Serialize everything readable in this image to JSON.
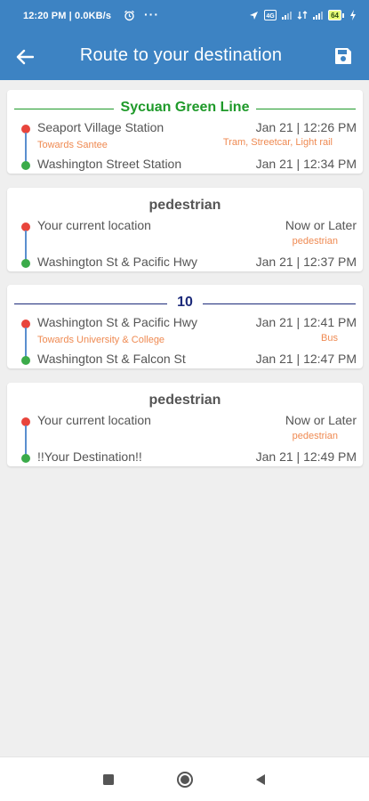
{
  "status_bar": {
    "time": "12:20 PM | 0.0KB/s",
    "more": "···",
    "battery": "64"
  },
  "app_bar": {
    "title": "Route to your destination",
    "back_icon": "arrow-left-icon",
    "save_icon": "floppy-disk-icon"
  },
  "colors": {
    "primary": "#3d83c3",
    "green_line": "#1f9a2a",
    "bus_route": "#1c2a7a",
    "orange_text": "#ef8a52",
    "origin_dot": "#e8453c",
    "destination_dot": "#3bab4a",
    "connector": "#5a8fcf"
  },
  "legs": [
    {
      "title": "Sycuan Green Line",
      "title_style": "green",
      "from": "Seaport Village Station",
      "from_time": "Jan 21 | 12:26 PM",
      "direction": "Towards Santee",
      "mode": "Tram, Streetcar, Light rail",
      "to": "Washington Street Station",
      "to_time": "Jan 21 | 12:34 PM"
    },
    {
      "title": "pedestrian",
      "title_style": "gray",
      "from": "Your current location",
      "from_time": "Now or Later",
      "direction": "",
      "mode": "pedestrian",
      "to": "Washington St & Pacific Hwy",
      "to_time": "Jan 21 | 12:37 PM"
    },
    {
      "title": "10",
      "title_style": "navy",
      "from": "Washington St & Pacific Hwy",
      "from_time": "Jan 21 | 12:41 PM",
      "direction": "Towards University & College",
      "mode": "Bus",
      "to": "Washington St & Falcon St",
      "to_time": "Jan 21 | 12:47 PM"
    },
    {
      "title": "pedestrian",
      "title_style": "gray",
      "from": "Your current location",
      "from_time": "Now or Later",
      "direction": "",
      "mode": "pedestrian",
      "to": "!!Your Destination!!",
      "to_time": "Jan 21 | 12:49 PM"
    }
  ],
  "nav_bar": {
    "recents_icon": "square-icon",
    "home_icon": "circle-icon",
    "back_icon": "triangle-back-icon"
  }
}
